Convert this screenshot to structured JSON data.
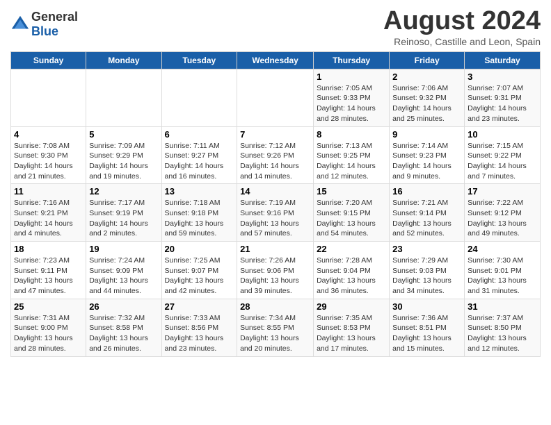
{
  "header": {
    "logo_general": "General",
    "logo_blue": "Blue",
    "main_title": "August 2024",
    "subtitle": "Reinoso, Castille and Leon, Spain"
  },
  "days_of_week": [
    "Sunday",
    "Monday",
    "Tuesday",
    "Wednesday",
    "Thursday",
    "Friday",
    "Saturday"
  ],
  "weeks": [
    [
      {
        "day": "",
        "info": ""
      },
      {
        "day": "",
        "info": ""
      },
      {
        "day": "",
        "info": ""
      },
      {
        "day": "",
        "info": ""
      },
      {
        "day": "1",
        "info": "Sunrise: 7:05 AM\nSunset: 9:33 PM\nDaylight: 14 hours and 28 minutes."
      },
      {
        "day": "2",
        "info": "Sunrise: 7:06 AM\nSunset: 9:32 PM\nDaylight: 14 hours and 25 minutes."
      },
      {
        "day": "3",
        "info": "Sunrise: 7:07 AM\nSunset: 9:31 PM\nDaylight: 14 hours and 23 minutes."
      }
    ],
    [
      {
        "day": "4",
        "info": "Sunrise: 7:08 AM\nSunset: 9:30 PM\nDaylight: 14 hours and 21 minutes."
      },
      {
        "day": "5",
        "info": "Sunrise: 7:09 AM\nSunset: 9:29 PM\nDaylight: 14 hours and 19 minutes."
      },
      {
        "day": "6",
        "info": "Sunrise: 7:11 AM\nSunset: 9:27 PM\nDaylight: 14 hours and 16 minutes."
      },
      {
        "day": "7",
        "info": "Sunrise: 7:12 AM\nSunset: 9:26 PM\nDaylight: 14 hours and 14 minutes."
      },
      {
        "day": "8",
        "info": "Sunrise: 7:13 AM\nSunset: 9:25 PM\nDaylight: 14 hours and 12 minutes."
      },
      {
        "day": "9",
        "info": "Sunrise: 7:14 AM\nSunset: 9:23 PM\nDaylight: 14 hours and 9 minutes."
      },
      {
        "day": "10",
        "info": "Sunrise: 7:15 AM\nSunset: 9:22 PM\nDaylight: 14 hours and 7 minutes."
      }
    ],
    [
      {
        "day": "11",
        "info": "Sunrise: 7:16 AM\nSunset: 9:21 PM\nDaylight: 14 hours and 4 minutes."
      },
      {
        "day": "12",
        "info": "Sunrise: 7:17 AM\nSunset: 9:19 PM\nDaylight: 14 hours and 2 minutes."
      },
      {
        "day": "13",
        "info": "Sunrise: 7:18 AM\nSunset: 9:18 PM\nDaylight: 13 hours and 59 minutes."
      },
      {
        "day": "14",
        "info": "Sunrise: 7:19 AM\nSunset: 9:16 PM\nDaylight: 13 hours and 57 minutes."
      },
      {
        "day": "15",
        "info": "Sunrise: 7:20 AM\nSunset: 9:15 PM\nDaylight: 13 hours and 54 minutes."
      },
      {
        "day": "16",
        "info": "Sunrise: 7:21 AM\nSunset: 9:14 PM\nDaylight: 13 hours and 52 minutes."
      },
      {
        "day": "17",
        "info": "Sunrise: 7:22 AM\nSunset: 9:12 PM\nDaylight: 13 hours and 49 minutes."
      }
    ],
    [
      {
        "day": "18",
        "info": "Sunrise: 7:23 AM\nSunset: 9:11 PM\nDaylight: 13 hours and 47 minutes."
      },
      {
        "day": "19",
        "info": "Sunrise: 7:24 AM\nSunset: 9:09 PM\nDaylight: 13 hours and 44 minutes."
      },
      {
        "day": "20",
        "info": "Sunrise: 7:25 AM\nSunset: 9:07 PM\nDaylight: 13 hours and 42 minutes."
      },
      {
        "day": "21",
        "info": "Sunrise: 7:26 AM\nSunset: 9:06 PM\nDaylight: 13 hours and 39 minutes."
      },
      {
        "day": "22",
        "info": "Sunrise: 7:28 AM\nSunset: 9:04 PM\nDaylight: 13 hours and 36 minutes."
      },
      {
        "day": "23",
        "info": "Sunrise: 7:29 AM\nSunset: 9:03 PM\nDaylight: 13 hours and 34 minutes."
      },
      {
        "day": "24",
        "info": "Sunrise: 7:30 AM\nSunset: 9:01 PM\nDaylight: 13 hours and 31 minutes."
      }
    ],
    [
      {
        "day": "25",
        "info": "Sunrise: 7:31 AM\nSunset: 9:00 PM\nDaylight: 13 hours and 28 minutes."
      },
      {
        "day": "26",
        "info": "Sunrise: 7:32 AM\nSunset: 8:58 PM\nDaylight: 13 hours and 26 minutes."
      },
      {
        "day": "27",
        "info": "Sunrise: 7:33 AM\nSunset: 8:56 PM\nDaylight: 13 hours and 23 minutes."
      },
      {
        "day": "28",
        "info": "Sunrise: 7:34 AM\nSunset: 8:55 PM\nDaylight: 13 hours and 20 minutes."
      },
      {
        "day": "29",
        "info": "Sunrise: 7:35 AM\nSunset: 8:53 PM\nDaylight: 13 hours and 17 minutes."
      },
      {
        "day": "30",
        "info": "Sunrise: 7:36 AM\nSunset: 8:51 PM\nDaylight: 13 hours and 15 minutes."
      },
      {
        "day": "31",
        "info": "Sunrise: 7:37 AM\nSunset: 8:50 PM\nDaylight: 13 hours and 12 minutes."
      }
    ]
  ]
}
